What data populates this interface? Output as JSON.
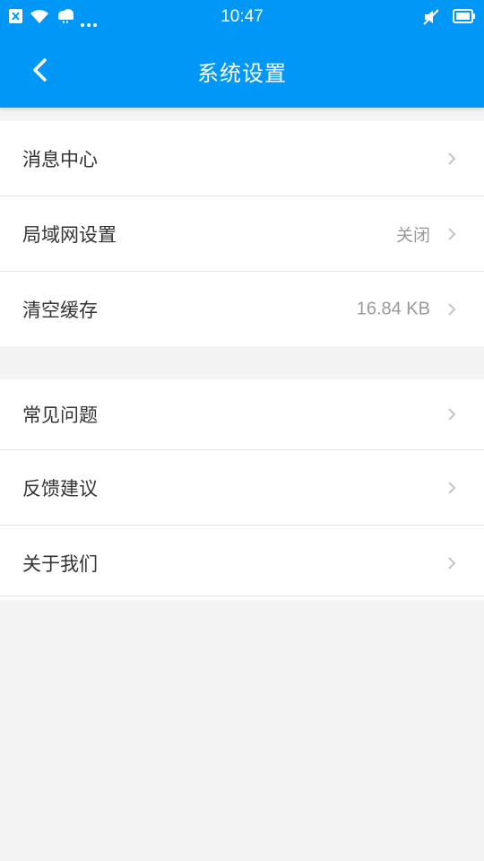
{
  "status_bar": {
    "time": "10:47",
    "left_icons": [
      "sim-x-icon",
      "wifi-icon",
      "cloud-icon",
      "more-dots-icon"
    ],
    "right_icons": [
      "mute-icon",
      "battery-icon"
    ]
  },
  "header": {
    "title": "系统设置",
    "back_icon": "chevron-left-icon",
    "color": "#0097f7"
  },
  "groups": [
    {
      "items": [
        {
          "label": "消息中心",
          "value": ""
        },
        {
          "label": "局域网设置",
          "value": "关闭"
        },
        {
          "label": "清空缓存",
          "value": "16.84 KB"
        }
      ]
    },
    {
      "items": [
        {
          "label": "常见问题",
          "value": ""
        },
        {
          "label": "反馈建议",
          "value": ""
        },
        {
          "label": "关于我们",
          "value": ""
        }
      ]
    }
  ]
}
